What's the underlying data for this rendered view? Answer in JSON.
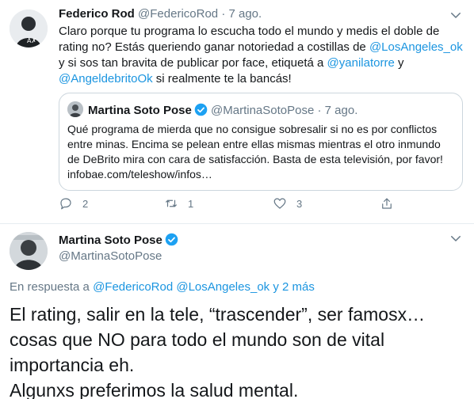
{
  "tweet": {
    "name": "Federico Rod",
    "handle": "@FedericoRod",
    "dot": "·",
    "time": "7 ago.",
    "text": {
      "p1": "Claro porque tu programa lo escucha todo el mundo y medis el doble de rating no? Estás queriendo ganar notoriedad a costillas de ",
      "m1": "@LosAngeles_ok",
      "p2": " y si sos tan bravita de publicar por face, etiquetá a ",
      "m2": "@yanilatorre",
      "p3": " y ",
      "m3": "@AngeldebritoOk",
      "p4": " si realmente te la bancás!"
    },
    "quote": {
      "name": "Martina Soto Pose",
      "handle": "@MartinaSotoPose",
      "dot": "·",
      "time": "7 ago.",
      "text": "Qué programa de mierda que no consigue sobresalir si no es por conflictos entre minas. Encima se pelean entre ellas mismas mientras el otro inmundo de DeBrito mira con cara de satisfacción. Basta de esta televisión, por favor! infobae.com/teleshow/infos…"
    },
    "actions": {
      "reply_count": "2",
      "retweet_count": "1",
      "like_count": "3"
    }
  },
  "reply": {
    "name": "Martina Soto Pose",
    "handle": "@MartinaSotoPose",
    "reply_prefix": "En respuesta a ",
    "reply_to_1": "@FedericoRod",
    "reply_to_2": "@LosAngeles_ok",
    "reply_suffix": " y 2 más",
    "text_line1": "El rating, salir en la tele, “trascender”, ser famosx… cosas que NO para todo el mundo son de vital importancia eh.",
    "text_line2": "Algunxs preferimos la salud mental."
  },
  "colors": {
    "accent": "#1b95e0",
    "muted": "#657786",
    "border": "#e6ecf0"
  },
  "icons": [
    "caret-down-icon",
    "verified-icon",
    "reply-icon",
    "retweet-icon",
    "like-icon",
    "share-icon"
  ]
}
